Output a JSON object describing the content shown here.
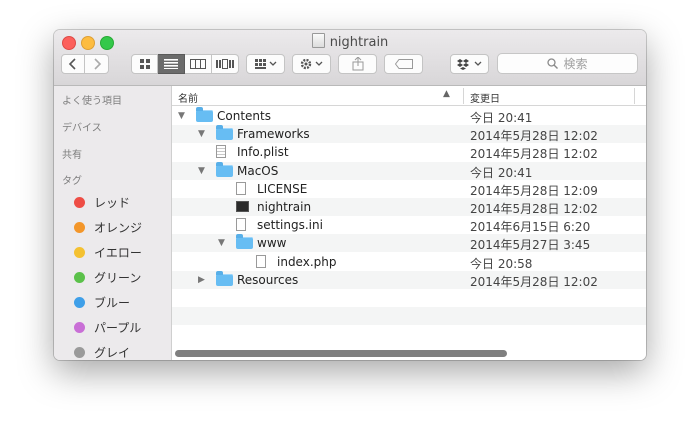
{
  "window": {
    "title": "nightrain"
  },
  "toolbar": {
    "search_placeholder": "検索",
    "colors": {
      "close": "#fc605c",
      "minimize": "#fdbc40",
      "maximize": "#34c84a"
    }
  },
  "sidebar": {
    "favorites_heading": "よく使う項目",
    "devices_heading": "デバイス",
    "shared_heading": "共有",
    "tags_heading": "タグ",
    "tags": [
      {
        "label": "レッド",
        "color": "#ee4d45"
      },
      {
        "label": "オレンジ",
        "color": "#f3962a"
      },
      {
        "label": "イエロー",
        "color": "#f4c131"
      },
      {
        "label": "グリーン",
        "color": "#5bc14a"
      },
      {
        "label": "ブルー",
        "color": "#3f9fe8"
      },
      {
        "label": "パープル",
        "color": "#c96fd6"
      },
      {
        "label": "グレイ",
        "color": "#9a9a9a"
      }
    ]
  },
  "file_list": {
    "columns": {
      "name": "名前",
      "modified": "変更日"
    },
    "rows": [
      {
        "name": "Contents",
        "modified": "今日 20:41",
        "kind": "folder",
        "expanded": true
      },
      {
        "name": "Frameworks",
        "modified": "2014年5月28日 12:02",
        "kind": "folder",
        "expanded": true
      },
      {
        "name": "Info.plist",
        "modified": "2014年5月28日 12:02",
        "kind": "plist"
      },
      {
        "name": "MacOS",
        "modified": "今日 20:41",
        "kind": "folder",
        "expanded": true
      },
      {
        "name": "LICENSE",
        "modified": "2014年5月28日 12:09",
        "kind": "doc"
      },
      {
        "name": "nightrain",
        "modified": "2014年5月28日 12:02",
        "kind": "exec"
      },
      {
        "name": "settings.ini",
        "modified": "2014年6月15日 6:20",
        "kind": "doc"
      },
      {
        "name": "www",
        "modified": "2014年5月27日 3:45",
        "kind": "folder",
        "expanded": true
      },
      {
        "name": "index.php",
        "modified": "今日 20:58",
        "kind": "doc"
      },
      {
        "name": "Resources",
        "modified": "2014年5月28日 12:02",
        "kind": "folder",
        "expanded": false
      }
    ]
  }
}
